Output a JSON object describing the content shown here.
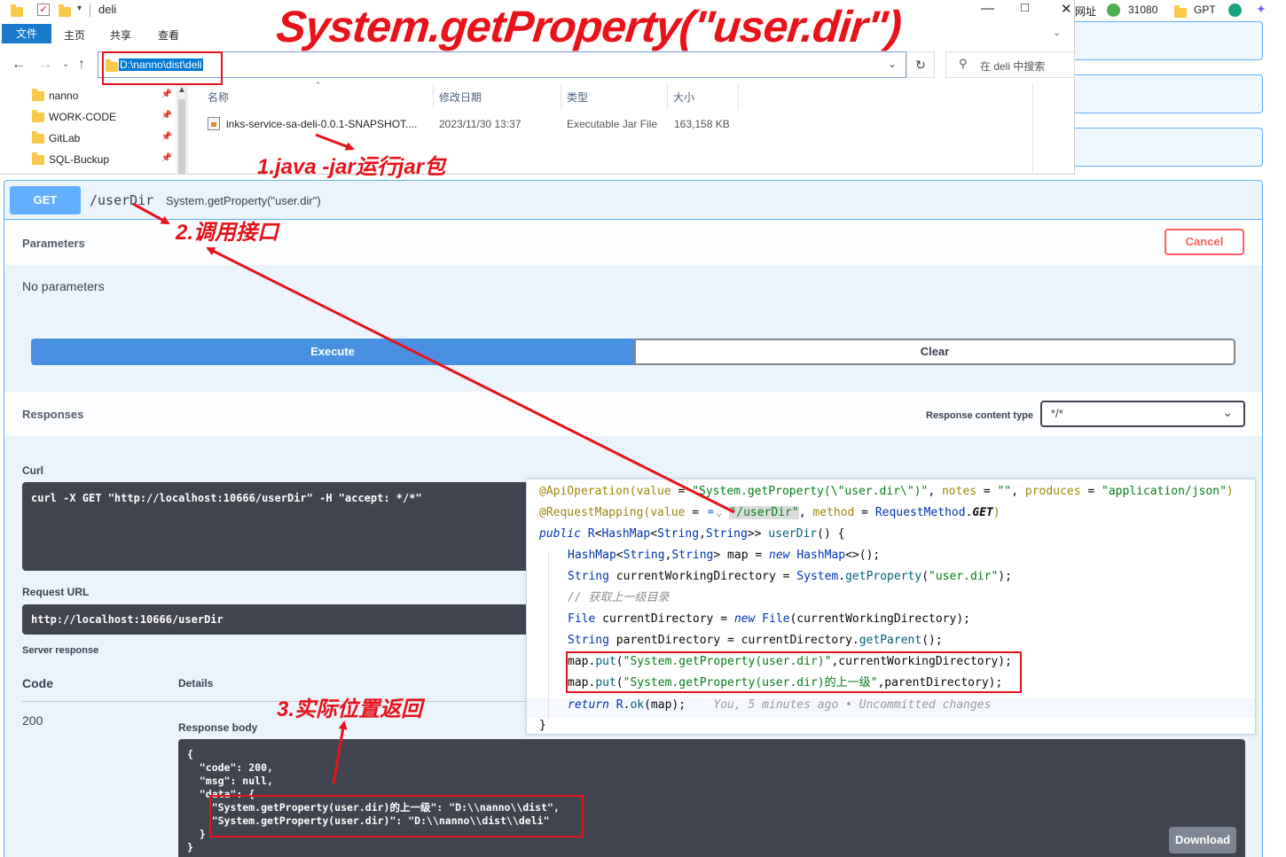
{
  "annotations": {
    "big_title": "System.getProperty(\"user.dir\")",
    "step1": "1.java -jar运行jar包",
    "step2": "2.调用接口",
    "step3": "3.实际位置返回"
  },
  "explorer": {
    "window_title": "deli",
    "ribbon_tabs": [
      "文件",
      "主页",
      "共享",
      "查看"
    ],
    "address": "D:\\nanno\\dist\\deli",
    "search_placeholder": "在 deli 中搜索",
    "nav_items": [
      "nanno",
      "WORK-CODE",
      "GitLab",
      "SQL-Buckup"
    ],
    "columns": [
      "名称",
      "修改日期",
      "类型",
      "大小"
    ],
    "file": {
      "name": "inks-service-sa-deli-0.0.1-SNAPSHOT....",
      "modified": "2023/11/30 13:37",
      "type": "Executable Jar File",
      "size": "163,158 KB"
    }
  },
  "tray": {
    "address_label": "网址",
    "count": "31080",
    "gpt": "GPT"
  },
  "swagger": {
    "method": "GET",
    "path": "/userDir",
    "summary": "System.getProperty(\"user.dir\")",
    "parameters_title": "Parameters",
    "cancel_label": "Cancel",
    "no_params": "No parameters",
    "execute_label": "Execute",
    "clear_label": "Clear",
    "responses_title": "Responses",
    "content_type_label": "Response content type",
    "content_type_value": "*/*",
    "curl_label": "Curl",
    "curl_command": "curl -X GET \"http://localhost:10666/userDir\" -H \"accept: */*\"",
    "request_url_label": "Request URL",
    "request_url": "http://localhost:10666/userDir",
    "server_response_label": "Server response",
    "code_header": "Code",
    "details_header": "Details",
    "status_code": "200",
    "response_body_label": "Response body",
    "response_body": "{\n  \"code\": 200,\n  \"msg\": null,\n  \"data\": {\n    \"System.getProperty(user.dir)的上一级\": \"D:\\\\nanno\\\\dist\",\n    \"System.getProperty(user.dir)\": \"D:\\\\nanno\\\\dist\\\\deli\"\n  }\n}",
    "download_label": "Download"
  },
  "colors": {
    "get_blue": "#61affe",
    "annotation_red": "#e8121b",
    "execute_blue": "#4990e2",
    "cancel_red": "#ff6060"
  }
}
